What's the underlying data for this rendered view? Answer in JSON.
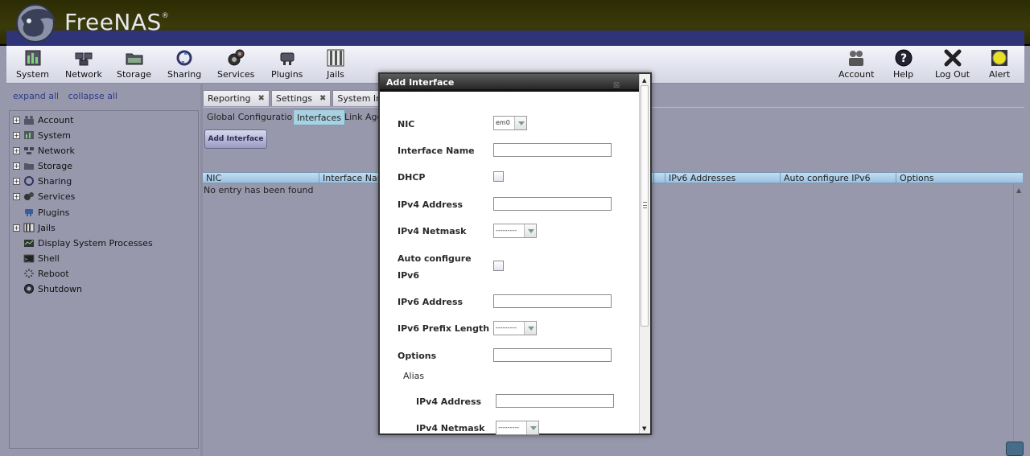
{
  "app": {
    "brand": "FreeNAS",
    "reg": "®"
  },
  "toolbar": {
    "left": [
      {
        "id": "system",
        "label": "System"
      },
      {
        "id": "network",
        "label": "Network"
      },
      {
        "id": "storage",
        "label": "Storage"
      },
      {
        "id": "sharing",
        "label": "Sharing"
      },
      {
        "id": "services",
        "label": "Services"
      },
      {
        "id": "plugins",
        "label": "Plugins"
      },
      {
        "id": "jails",
        "label": "Jails"
      }
    ],
    "right": [
      {
        "id": "account",
        "label": "Account"
      },
      {
        "id": "help",
        "label": "Help"
      },
      {
        "id": "logout",
        "label": "Log Out"
      },
      {
        "id": "alert",
        "label": "Alert"
      }
    ]
  },
  "sidebar": {
    "expand_all": "expand all",
    "collapse_all": "collapse all",
    "items": [
      {
        "label": "Account",
        "expandable": true,
        "icon": "account-icon"
      },
      {
        "label": "System",
        "expandable": true,
        "icon": "system-icon"
      },
      {
        "label": "Network",
        "expandable": true,
        "icon": "network-icon"
      },
      {
        "label": "Storage",
        "expandable": true,
        "icon": "storage-icon"
      },
      {
        "label": "Sharing",
        "expandable": true,
        "icon": "sharing-icon"
      },
      {
        "label": "Services",
        "expandable": true,
        "icon": "services-icon"
      },
      {
        "label": "Plugins",
        "expandable": false,
        "icon": "plugins-icon"
      },
      {
        "label": "Jails",
        "expandable": true,
        "icon": "jails-icon"
      },
      {
        "label": "Display System Processes",
        "expandable": false,
        "icon": "processes-icon"
      },
      {
        "label": "Shell",
        "expandable": false,
        "icon": "shell-icon"
      },
      {
        "label": "Reboot",
        "expandable": false,
        "icon": "reboot-icon"
      },
      {
        "label": "Shutdown",
        "expandable": false,
        "icon": "shutdown-icon"
      }
    ]
  },
  "main": {
    "tabs": [
      {
        "label": "Reporting",
        "close": "✖"
      },
      {
        "label": "Settings",
        "close": "✖"
      },
      {
        "label": "System Infor",
        "close": ""
      }
    ],
    "subtabs": {
      "global": "Global Configuration",
      "interfaces": "Interfaces",
      "linkagg": "Link Agg"
    },
    "add_button": "Add Interface",
    "grid": {
      "columns": [
        "NIC",
        "Interface Nam",
        "",
        "IPv6 Addresses",
        "Auto configure IPv6",
        "Options"
      ],
      "empty": "No entry has been found"
    }
  },
  "modal": {
    "title": "Add Interface",
    "close": "☒",
    "fields": {
      "nic_label": "NIC",
      "nic_value": "em0",
      "iface_name_label": "Interface Name",
      "dhcp_label": "DHCP",
      "ipv4_addr_label": "IPv4 Address",
      "ipv4_mask_label": "IPv4 Netmask",
      "ipv4_mask_value": "---------",
      "autoconf_label_1": "Auto configure",
      "autoconf_label_2": "IPv6",
      "ipv6_addr_label": "IPv6 Address",
      "ipv6_prefix_label": "IPv6 Prefix Length",
      "ipv6_prefix_value": "---------",
      "options_label": "Options",
      "alias_label": "Alias",
      "alias_ipv4_addr_label": "IPv4 Address",
      "alias_ipv4_mask_label": "IPv4 Netmask",
      "alias_ipv4_mask_value": "---------"
    }
  }
}
